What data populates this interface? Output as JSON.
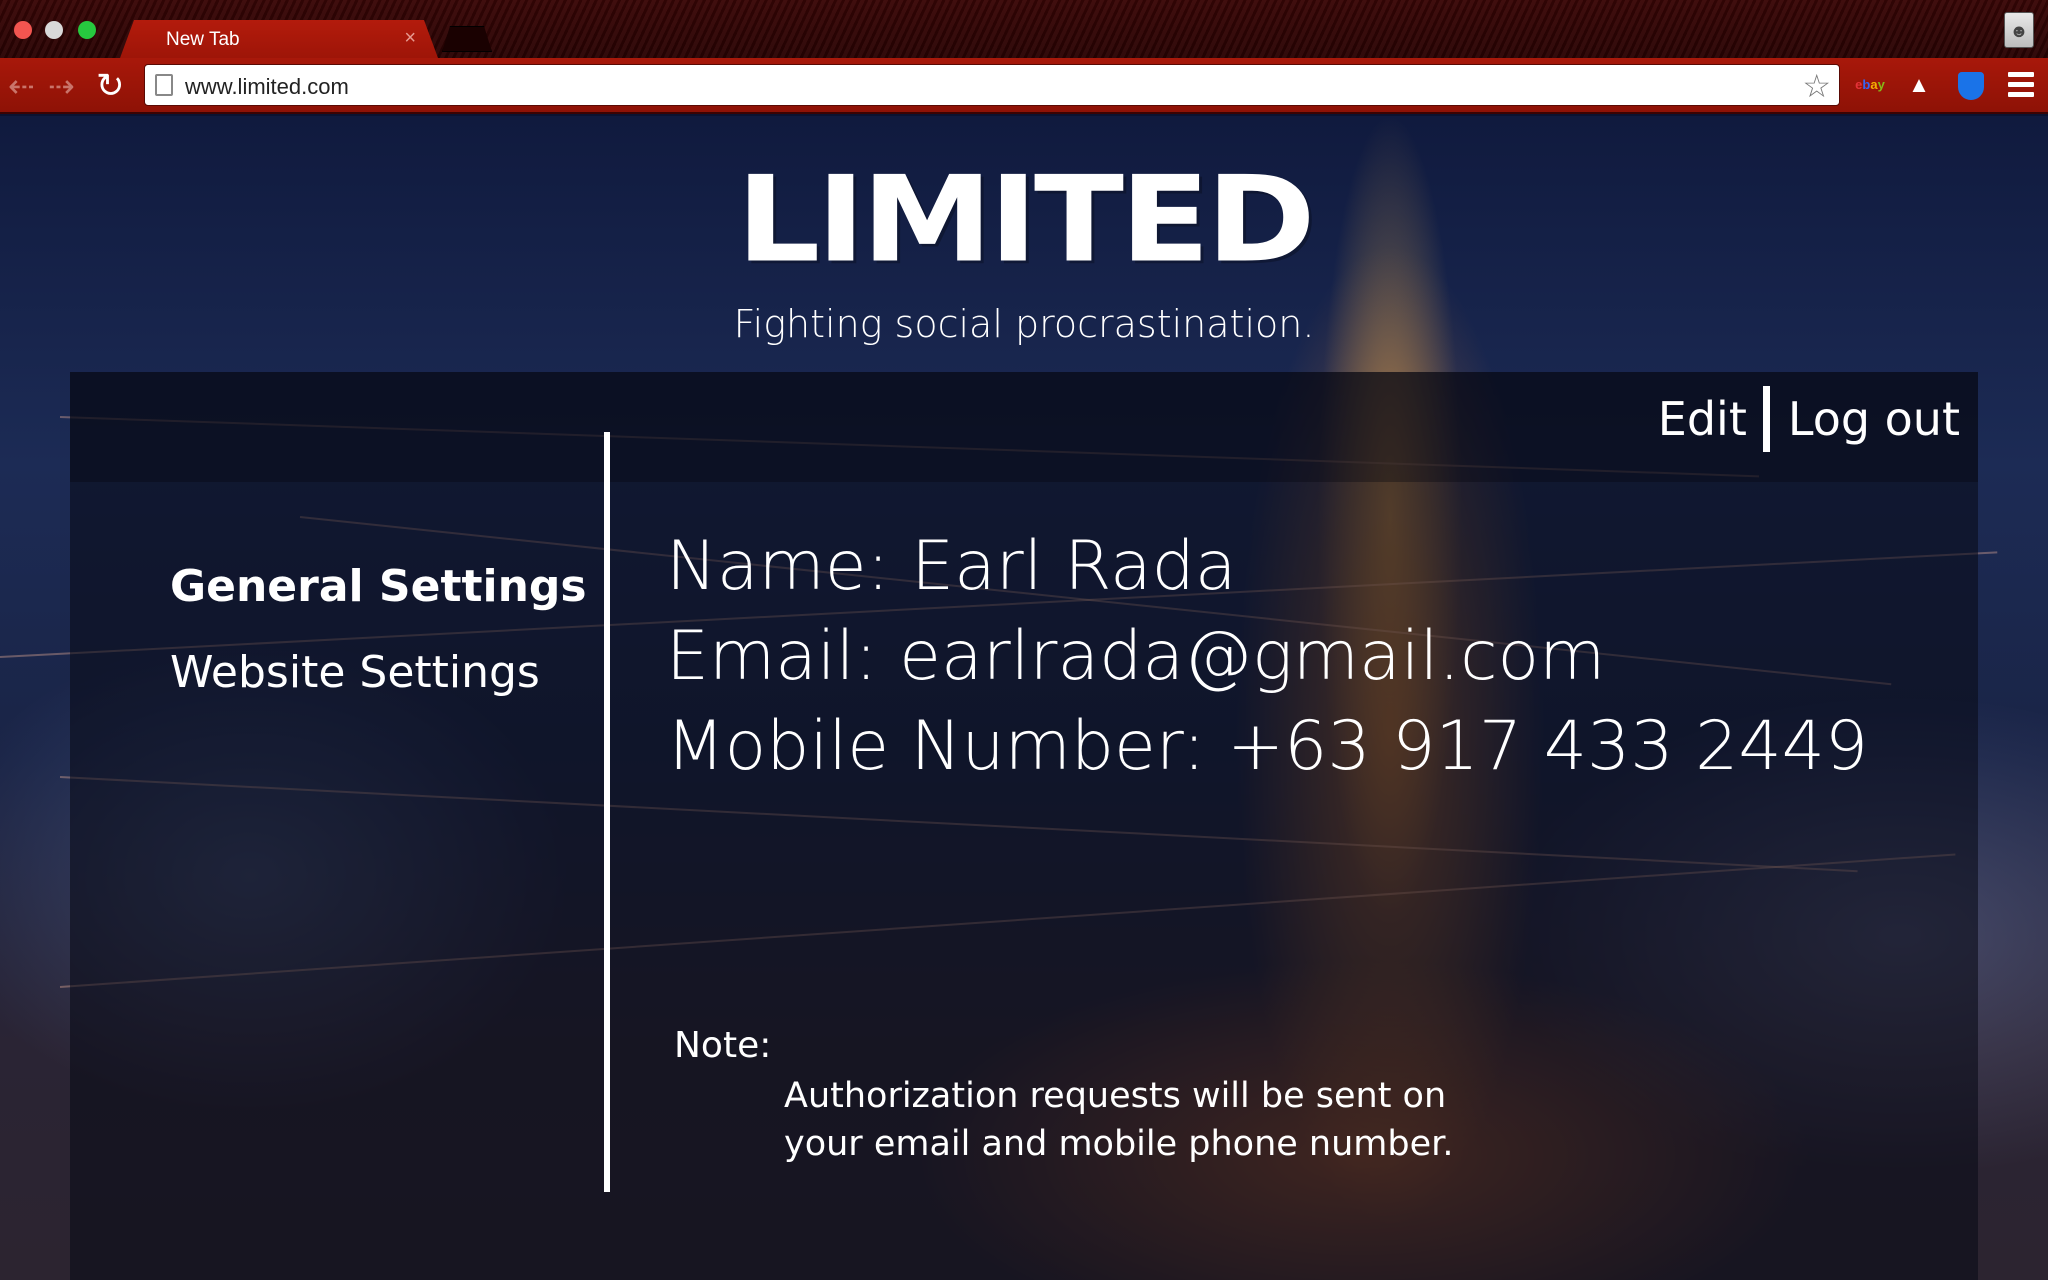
{
  "browser": {
    "tab_title": "New Tab",
    "tab_close": "×",
    "url": "www.limited.com",
    "extensions": [
      "ebay-icon",
      "triangle-icon",
      "shield-icon"
    ]
  },
  "site": {
    "logo": "LIMITED",
    "tagline": "Fighting social procrastination."
  },
  "header_links": {
    "edit": "Edit",
    "logout": "Log out"
  },
  "sidebar": {
    "items": [
      {
        "label": "General Settings",
        "active": true
      },
      {
        "label": "Website Settings",
        "active": false
      }
    ]
  },
  "profile": {
    "name_line": "Name: Earl Rada",
    "email_line": "Email: earlrada@gmail.com",
    "mobile_line": "Mobile Number: +63 917 433 2449"
  },
  "note": {
    "label": "Note:",
    "line1": "Authorization requests will be sent on",
    "line2": "your email and mobile phone number."
  },
  "colors": {
    "chrome_red": "#a8180a",
    "text": "#ffffff"
  }
}
